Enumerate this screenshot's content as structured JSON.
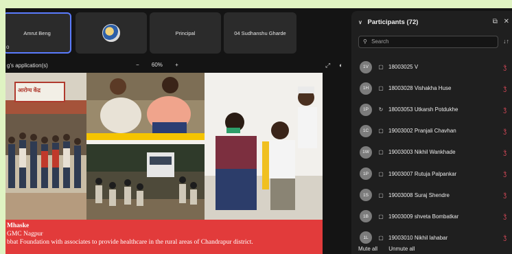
{
  "tiles": [
    {
      "label": "Amrut Beng",
      "active": true
    },
    {
      "label": "",
      "logo": true
    },
    {
      "label": "Principal"
    },
    {
      "label": "04 Sudhanshu Gharde"
    }
  ],
  "share": {
    "title": "g's application(s)",
    "zoom_minus": "−",
    "zoom_level": "60%",
    "zoom_plus": "+"
  },
  "slide": {
    "caption_line1": "Mhaske",
    "caption_line2": "GMC Nagpur",
    "caption_line3": "bbat Foundation with associates to provide healthcare in the rural areas of Chandrapur district.",
    "sign_text": "आरोग्य केंद्र"
  },
  "panel": {
    "title": "Participants (72)",
    "search_placeholder": "Search",
    "mute_all": "Mute all",
    "unmute_all": "Unmute all",
    "participants": [
      {
        "initials": "1V",
        "name": "18003025 V",
        "icon": "device"
      },
      {
        "initials": "1H",
        "name": "18003028 Vishakha Huse",
        "icon": "device"
      },
      {
        "initials": "1P",
        "name": "18003053 Utkarsh Potdukhe",
        "icon": "sync"
      },
      {
        "initials": "1C",
        "name": "19003002 Pranjali Chavhan",
        "icon": "device"
      },
      {
        "initials": "1W",
        "name": "19003003 Nikhil Wankhade",
        "icon": "device"
      },
      {
        "initials": "1P",
        "name": "19003007 Rutuja Palpankar",
        "icon": "device"
      },
      {
        "initials": "1S",
        "name": "19003008 Suraj Shendre",
        "icon": "device"
      },
      {
        "initials": "1B",
        "name": "19003009 shveta Bombatkar",
        "icon": "device"
      },
      {
        "initials": "1L",
        "name": "19003010 Nikhil lahabar",
        "icon": "device"
      }
    ]
  },
  "colors": {
    "caption_bg": "#e23b3b",
    "mic_muted": "#e04a5a",
    "active_border": "#5b7cff"
  }
}
